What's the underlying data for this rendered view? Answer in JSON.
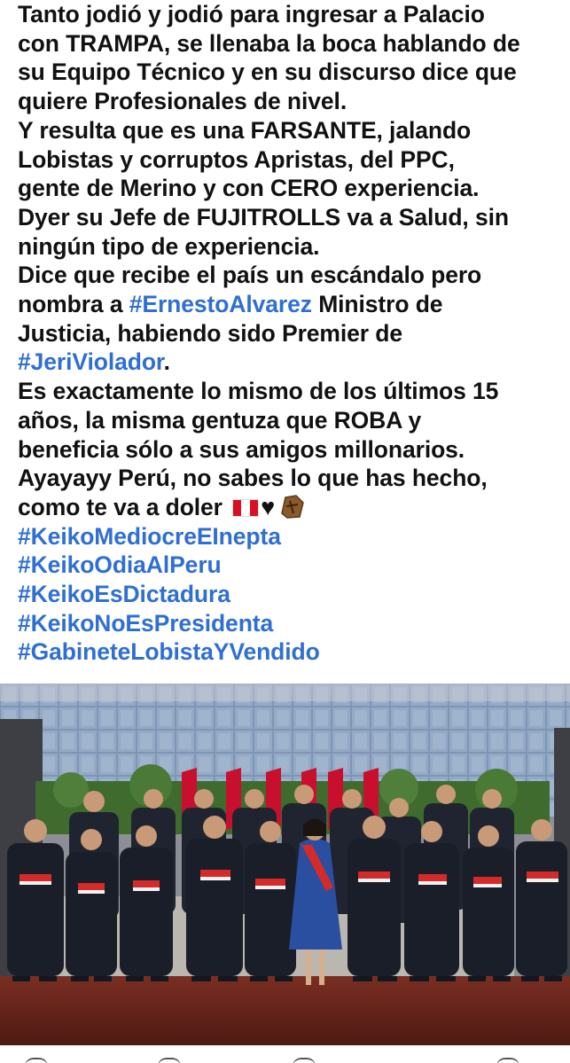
{
  "post": {
    "lines": [
      "Tanto jodió y jodió para ingresar a Palacio",
      "con TRAMPA, se llenaba la boca hablando de",
      "su Equipo Técnico y en su discurso dice que",
      "quiere Profesionales de nivel.",
      "Y resulta que es una FARSANTE, jalando",
      "Lobistas y corruptos Apristas, del PPC,",
      "gente de Merino y con CERO experiencia.",
      "Dyer su Jefe de FUJITROLLS va a Salud, sin",
      "ningún tipo de experiencia.",
      "Dice que recibe el país un escándalo pero"
    ],
    "line11_pre": "nombra a ",
    "line11_tag": "#ErnestoAlvarez",
    "line11_post": " Ministro de",
    "line12": "Justicia, habiendo sido Premier de",
    "line13_tag": "#JeriViolador",
    "line13_post": ".",
    "lines2": [
      "Es exactamente lo mismo de los últimos 15",
      "años, la misma gentuza que ROBA y",
      "beneficia sólo a sus amigos millonarios.",
      "Ayayayy Perú, no sabes lo que has hecho,"
    ],
    "line18": "como te va a doler",
    "emojis": [
      "peru-flag",
      "black-heart",
      "coffin"
    ],
    "hashtags": [
      "#KeikoMediocreEInepta",
      "#KeikoOdiaAlPeru",
      "#KeikoEsDictadura",
      "#KeikoNoEsPresidenta",
      "#GabineteLobistaYVendido"
    ]
  },
  "colors": {
    "text": "#111111",
    "hashtag": "#2f6fd3",
    "background": "#ffffff"
  },
  "photo": {
    "subject": "cabinet-group-photo"
  }
}
